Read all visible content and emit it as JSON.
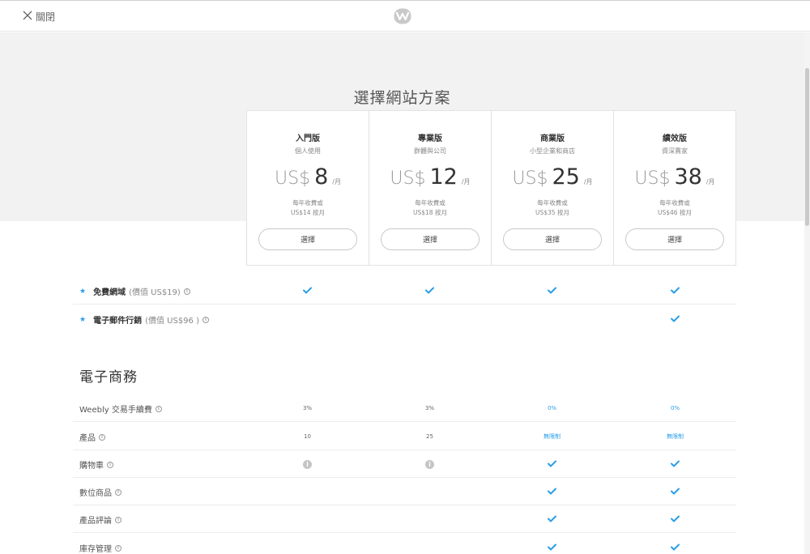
{
  "header": {
    "close_label": "關閉",
    "logo": "weebly-w-logo"
  },
  "hero": {
    "title": "選擇網站方案"
  },
  "plans": [
    {
      "name": "入門版",
      "subtitle": "個人使用",
      "currency": "US$",
      "amount": "8",
      "period": "/月",
      "note_line1": "每年收費或",
      "note_line2": "US$14 按月",
      "button": "選擇"
    },
    {
      "name": "專業版",
      "subtitle": "群體與公司",
      "currency": "US$",
      "amount": "12",
      "period": "/月",
      "note_line1": "每年收費或",
      "note_line2": "US$18 按月",
      "button": "選擇"
    },
    {
      "name": "商業版",
      "subtitle": "小型企業和商店",
      "currency": "US$",
      "amount": "25",
      "period": "/月",
      "note_line1": "每年收費或",
      "note_line2": "US$35 按月",
      "button": "選擇"
    },
    {
      "name": "績效版",
      "subtitle": "資深賣家",
      "currency": "US$",
      "amount": "38",
      "period": "/月",
      "note_line1": "每年收費或",
      "note_line2": "US$46 按月",
      "button": "選擇"
    }
  ],
  "highlights": [
    {
      "label": "免費網域",
      "value_note": "(價值 US$19)",
      "cells": [
        "check",
        "check",
        "check",
        "check"
      ]
    },
    {
      "label": "電子郵件行銷",
      "value_note": "(價值 US$96 )",
      "cells": [
        "",
        "",
        "",
        "check"
      ]
    }
  ],
  "ecommerce": {
    "title": "電子商務",
    "rows": [
      {
        "label": "Weebly 交易手續費",
        "cells": [
          "3%",
          "3%",
          "0%",
          "0%"
        ]
      },
      {
        "label": "產品",
        "cells": [
          "10",
          "25",
          "無限制",
          "無限制"
        ]
      },
      {
        "label": "購物車",
        "cells": [
          "info",
          "info",
          "check",
          "check"
        ]
      },
      {
        "label": "數位商品",
        "cells": [
          "",
          "",
          "check",
          "check"
        ]
      },
      {
        "label": "產品評論",
        "cells": [
          "",
          "",
          "check",
          "check"
        ]
      },
      {
        "label": "庫存管理",
        "cells": [
          "",
          "",
          "check",
          "check"
        ]
      }
    ]
  },
  "colors": {
    "accent": "#2a9ee8",
    "hero_bg": "#f2f2f2"
  }
}
